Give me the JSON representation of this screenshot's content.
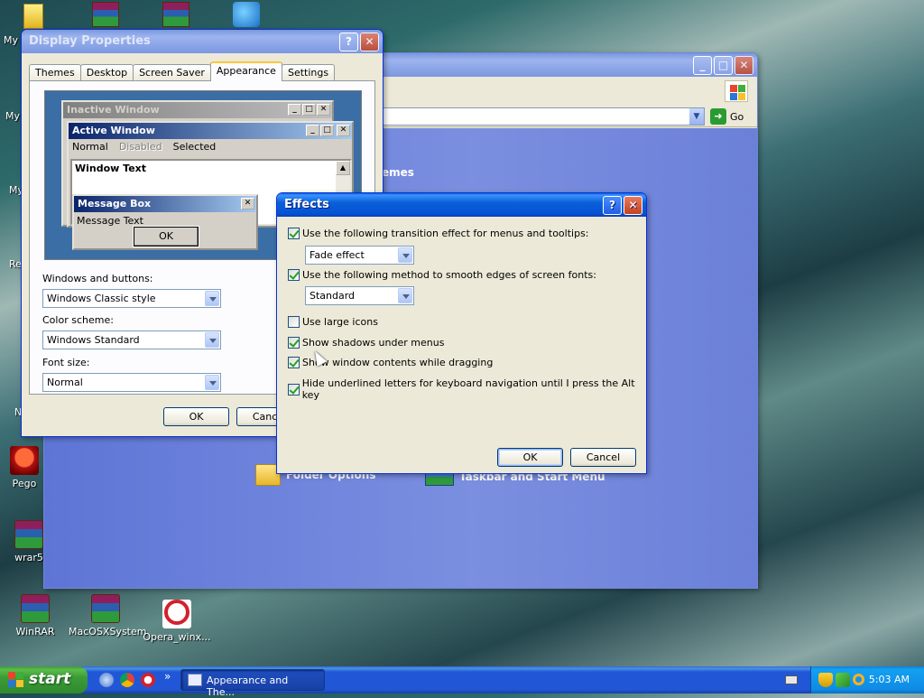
{
  "desktop": {
    "icons": [
      {
        "label": "WinRAR"
      },
      {
        "label": "MacOSXSystem"
      },
      {
        "label": "Opera_winx..."
      },
      {
        "label": "wrar5"
      },
      {
        "label": "Pego"
      }
    ],
    "clipped_labels": [
      "My I",
      "My",
      "My",
      "Re",
      "N"
    ]
  },
  "control_panel": {
    "go_label": "Go",
    "partial_heading": "emes",
    "tasks": [
      {
        "label": "Folder Options"
      },
      {
        "label": "Taskbar and Start Menu"
      }
    ]
  },
  "display_properties": {
    "title": "Display Properties",
    "tabs": [
      "Themes",
      "Desktop",
      "Screen Saver",
      "Appearance",
      "Settings"
    ],
    "active_tab": "Appearance",
    "preview": {
      "inactive_window": "Inactive Window",
      "active_window": "Active Window",
      "menu_items": [
        "Normal",
        "Disabled",
        "Selected"
      ],
      "window_text": "Window Text",
      "message_box": "Message Box",
      "message_text": "Message Text",
      "ok_label": "OK"
    },
    "windows_buttons_label": "Windows and buttons:",
    "windows_buttons_value": "Windows Classic style",
    "color_scheme_label": "Color scheme:",
    "color_scheme_value": "Windows Standard",
    "font_size_label": "Font size:",
    "font_size_value": "Normal",
    "ok_label": "OK",
    "cancel_label": "Cancel"
  },
  "effects": {
    "title": "Effects",
    "options": [
      {
        "label": "Use the following transition effect for menus and tooltips:",
        "checked": true
      },
      {
        "label": "Use the following method to smooth edges of screen fonts:",
        "checked": true
      },
      {
        "label": "Use large icons",
        "checked": false
      },
      {
        "label": "Show shadows under menus",
        "checked": true
      },
      {
        "label": "Show window contents while dragging",
        "checked": true
      },
      {
        "label": "Hide underlined letters for keyboard navigation until I press the Alt key",
        "checked": true
      }
    ],
    "transition_value": "Fade effect",
    "smoothing_value": "Standard",
    "ok_label": "OK",
    "cancel_label": "Cancel"
  },
  "taskbar": {
    "start_label": "start",
    "task_label": "Appearance and The...",
    "clock": "5:03 AM",
    "quicklaunch_more": "»"
  },
  "icons": {
    "help": "?",
    "close": "✕",
    "minimize": "_",
    "maximize": "□",
    "scroll_up": "▲",
    "go_arrow": "➜"
  },
  "colors": {
    "xp_title_blue": "#0a5fd8",
    "control_panel_blue": "#6b80d8",
    "start_green": "#3d9b38",
    "close_red": "#c4411e"
  }
}
